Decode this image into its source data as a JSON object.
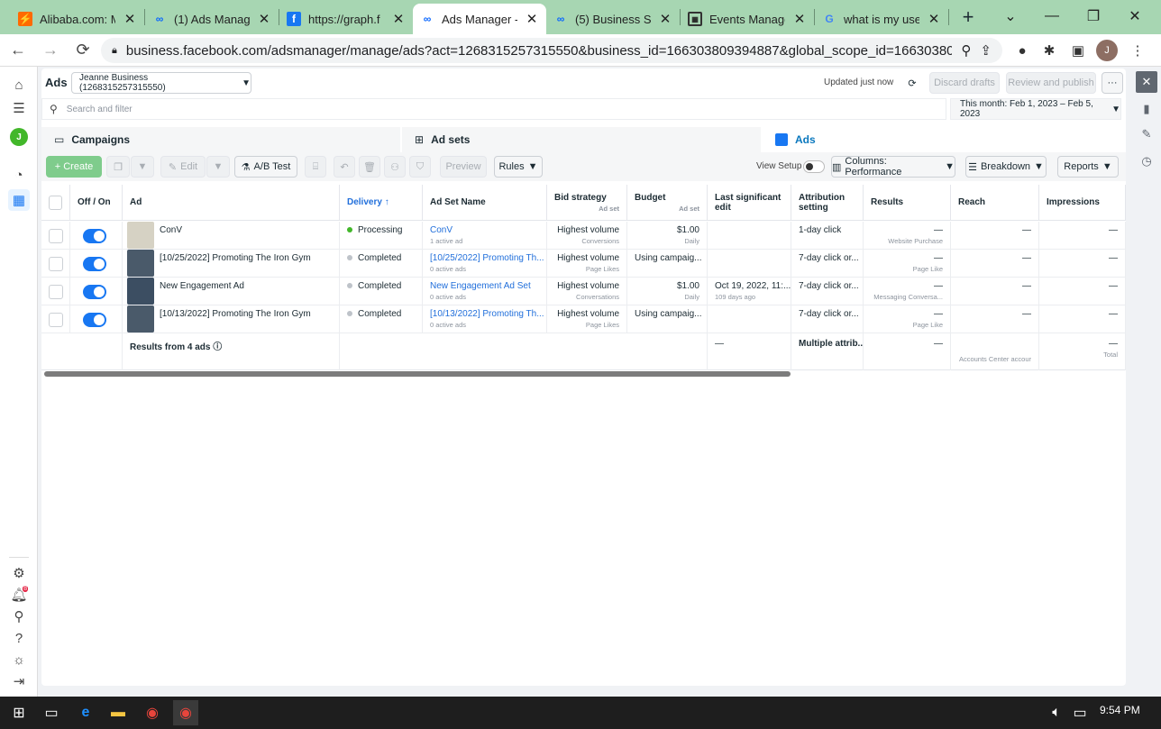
{
  "browser": {
    "tabs": [
      {
        "title": "Alibaba.com: M",
        "icon": "alibaba-icon",
        "active": false
      },
      {
        "title": "(1) Ads Manag",
        "icon": "meta-icon",
        "active": false
      },
      {
        "title": "https://graph.f",
        "icon": "facebook-icon",
        "active": false
      },
      {
        "title": "Ads Manager -",
        "icon": "meta-icon",
        "active": true
      },
      {
        "title": "(5) Business Se",
        "icon": "meta-icon",
        "active": false
      },
      {
        "title": "Events Manage",
        "icon": "events-icon",
        "active": false
      },
      {
        "title": "what is my use",
        "icon": "google-icon",
        "active": false
      }
    ],
    "url": "business.facebook.com/adsmanager/manage/ads?act=1268315257315550&business_id=166303809394887&global_scope_id=166303809...",
    "profile_initial": "J"
  },
  "left_nav": {
    "avatar_initial": "J",
    "notification_count": "8"
  },
  "header": {
    "title": "Ads",
    "account": "Jeanne Business (1268315257315550)",
    "updated": "Updated just now",
    "discard": "Discard drafts",
    "review": "Review and publish",
    "more": "···"
  },
  "search": {
    "placeholder": "Search and filter",
    "date_range": "This month: Feb 1, 2023 – Feb 5, 2023"
  },
  "level_tabs": [
    {
      "label": "Campaigns",
      "icon": "folder-icon"
    },
    {
      "label": "Ad sets",
      "icon": "grid-icon"
    },
    {
      "label": "Ads",
      "icon": "ad-icon"
    }
  ],
  "toolbar": {
    "create": "+ Create",
    "edit": "Edit",
    "ab_test": "A/B Test",
    "preview": "Preview",
    "rules": "Rules",
    "view_setup": "View Setup",
    "columns": "Columns: Performance",
    "breakdown": "Breakdown",
    "reports": "Reports"
  },
  "table": {
    "headers": {
      "off_on": "Off / On",
      "ad": "Ad",
      "delivery": "Delivery ↑",
      "ad_set_name": "Ad Set Name",
      "bid_strategy": "Bid strategy",
      "bid_strategy_sub": "Ad set",
      "budget": "Budget",
      "budget_sub": "Ad set",
      "last_edit": "Last significant edit",
      "attribution": "Attribution setting",
      "results": "Results",
      "reach": "Reach",
      "impressions": "Impressions"
    },
    "rows": [
      {
        "ad": "ConV",
        "delivery": "Processing",
        "delivery_color": "#42b72a",
        "adset": "ConV",
        "adset_sub": "1 active ad",
        "bid": "Highest volume",
        "bid_sub": "Conversions",
        "budget": "$1.00",
        "budget_sub": "Daily",
        "last_edit": "",
        "last_edit_sub": "",
        "attribution": "1-day click",
        "results": "—",
        "results_sub": "Website Purchase",
        "reach": "—",
        "impressions": "—"
      },
      {
        "ad": "[10/25/2022] Promoting The Iron Gym",
        "delivery": "Completed",
        "delivery_color": "#bec3c9",
        "adset": "[10/25/2022] Promoting Th...",
        "adset_sub": "0 active ads",
        "bid": "Highest volume",
        "bid_sub": "Page Likes",
        "budget": "Using campaig...",
        "budget_sub": "",
        "last_edit": "",
        "last_edit_sub": "",
        "attribution": "7-day click or...",
        "results": "—",
        "results_sub": "Page Like",
        "reach": "—",
        "impressions": "—"
      },
      {
        "ad": "New Engagement Ad",
        "delivery": "Completed",
        "delivery_color": "#bec3c9",
        "adset": "New Engagement Ad Set",
        "adset_sub": "0 active ads",
        "bid": "Highest volume",
        "bid_sub": "Conversations",
        "budget": "$1.00",
        "budget_sub": "Daily",
        "last_edit": "Oct 19, 2022, 11:...",
        "last_edit_sub": "109 days ago",
        "attribution": "7-day click or...",
        "results": "—",
        "results_sub": "Messaging Conversa...",
        "reach": "—",
        "impressions": "—"
      },
      {
        "ad": "[10/13/2022] Promoting The Iron Gym",
        "delivery": "Completed",
        "delivery_color": "#bec3c9",
        "adset": "[10/13/2022] Promoting Th...",
        "adset_sub": "0 active ads",
        "bid": "Highest volume",
        "bid_sub": "Page Likes",
        "budget": "Using campaig...",
        "budget_sub": "",
        "last_edit": "",
        "last_edit_sub": "",
        "attribution": "7-day click or...",
        "results": "—",
        "results_sub": "Page Like",
        "reach": "—",
        "impressions": "—"
      }
    ],
    "summary": {
      "label": "Results from 4 ads",
      "last_edit": "—",
      "attribution": "Multiple attrib...",
      "results": "—",
      "reach_sub": "Accounts Center accour",
      "impressions": "—",
      "impressions_sub": "Total"
    }
  },
  "taskbar": {
    "time": "9:54 PM"
  }
}
